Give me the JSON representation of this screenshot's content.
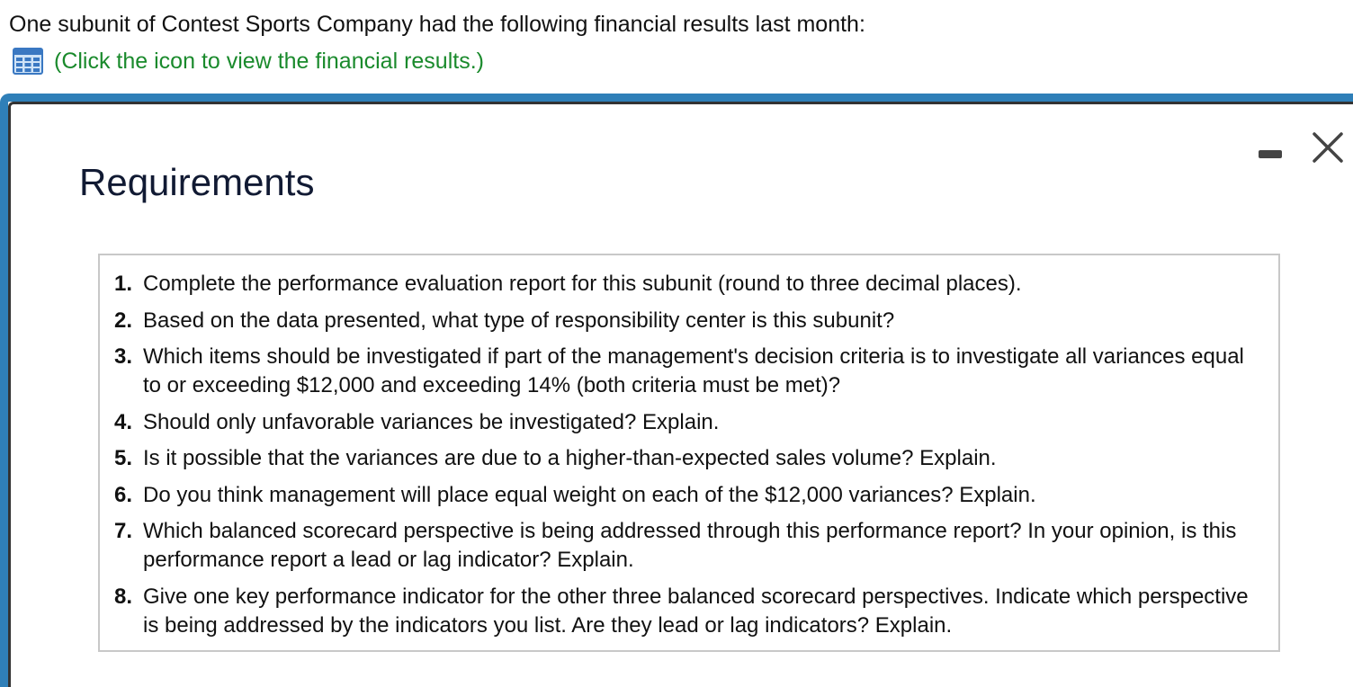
{
  "intro": {
    "text": "One subunit of Contest Sports Company had the following financial results last month:"
  },
  "link": {
    "icon": "table-icon",
    "text": "(Click the icon to view the financial results.)",
    "color": "#1a8a2c"
  },
  "modal": {
    "title": "Requirements",
    "border_color": "#2f7fb8",
    "minimize_icon": "minimize-icon",
    "close_icon": "close-icon",
    "requirements": [
      {
        "num": "1.",
        "text": "Complete the performance evaluation report for this subunit (round to three decimal places)."
      },
      {
        "num": "2.",
        "text": "Based on the data presented, what type of responsibility center is this subunit?"
      },
      {
        "num": "3.",
        "text": "Which items should be investigated if part of the management's decision criteria is to investigate all variances equal to or exceeding $12,000 and exceeding 14% (both criteria must be met)?"
      },
      {
        "num": "4.",
        "text": "Should only unfavorable variances be investigated? Explain."
      },
      {
        "num": "5.",
        "text": "Is it possible that the variances are due to a higher-than-expected sales volume? Explain."
      },
      {
        "num": "6.",
        "text": "Do you think management will place equal weight on each of the $12,000 variances? Explain."
      },
      {
        "num": "7.",
        "text": "Which balanced scorecard perspective is being addressed through this performance report? In your opinion, is this performance report a lead or lag indicator? Explain."
      },
      {
        "num": "8.",
        "text": "Give one key performance indicator for the other three balanced scorecard perspectives. Indicate which perspective is being addressed by the indicators you list. Are they lead or lag indicators? Explain."
      }
    ]
  }
}
